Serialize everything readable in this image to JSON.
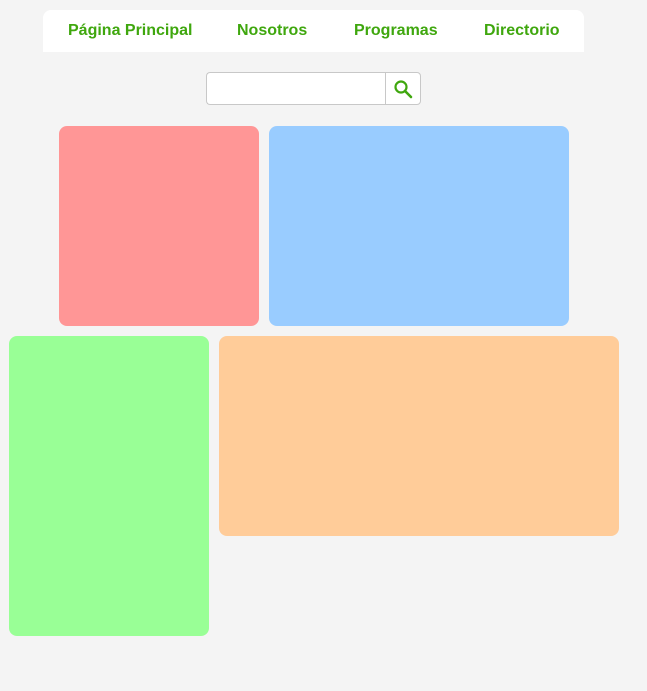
{
  "nav": {
    "items": [
      {
        "label": "Página Principal"
      },
      {
        "label": "Nosotros"
      },
      {
        "label": "Programas"
      },
      {
        "label": "Directorio"
      }
    ],
    "color": "#3fa70e"
  },
  "search": {
    "value": "",
    "placeholder": "",
    "icon": "search-icon",
    "icon_color": "#3fa70e"
  },
  "tiles": [
    {
      "color": "#ff9696"
    },
    {
      "color": "#99ccff"
    },
    {
      "color": "#99ff96"
    },
    {
      "color": "#ffcc99"
    }
  ],
  "colors": {
    "background": "#f4f4f4",
    "nav_background": "#ffffff"
  }
}
